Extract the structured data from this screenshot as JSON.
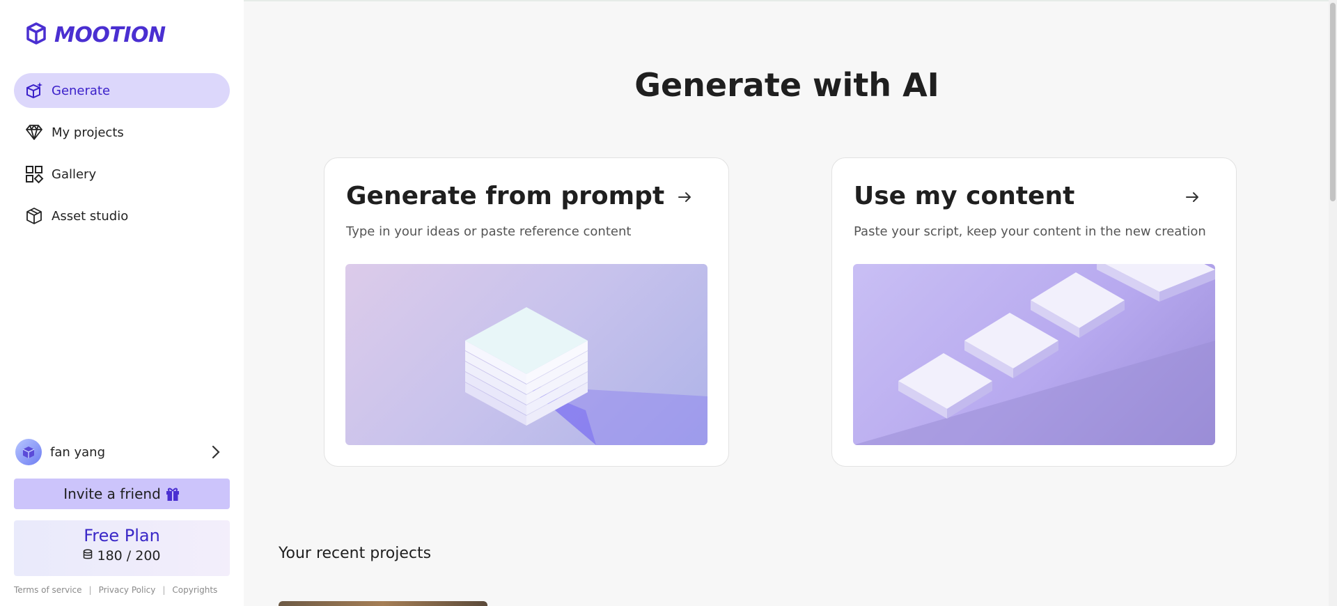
{
  "app": {
    "logo_text": "MOOTION"
  },
  "sidebar": {
    "items": [
      {
        "label": "Generate",
        "icon": "generate-icon",
        "active": true
      },
      {
        "label": "My projects",
        "icon": "diamond-icon"
      },
      {
        "label": "Gallery",
        "icon": "grid-icon"
      },
      {
        "label": "Asset studio",
        "icon": "box-icon"
      }
    ],
    "user": {
      "name": "fan yang"
    },
    "invite_label": "Invite a friend",
    "plan": {
      "title": "Free Plan",
      "credits": "180 / 200"
    },
    "footer": {
      "terms": "Terms of service",
      "privacy": "Privacy Policy",
      "copyrights": "Copyrights",
      "separator": "|"
    }
  },
  "main": {
    "title": "Generate with AI",
    "cards": [
      {
        "title": "Generate from prompt",
        "subtitle": "Type in your ideas or paste reference content"
      },
      {
        "title": "Use my content",
        "subtitle": "Paste your script, keep your content in the new creation"
      }
    ],
    "recent_heading": "Your recent projects"
  },
  "colors": {
    "accent": "#4a2fd1",
    "active_bg": "#dcd7fb",
    "invite_bg": "#ccc4fb"
  }
}
